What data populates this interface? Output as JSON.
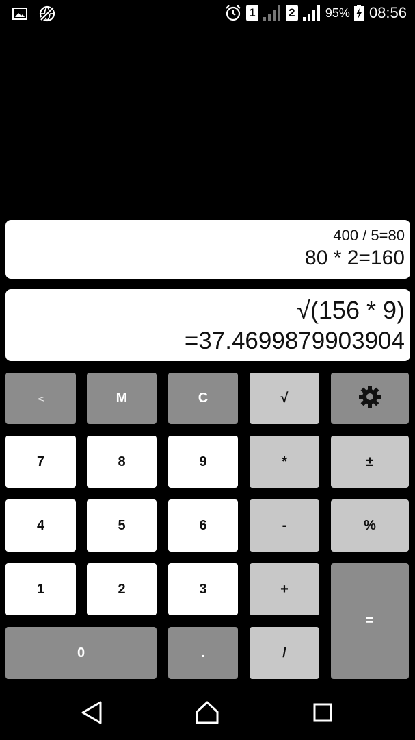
{
  "status_bar": {
    "icons_left": [
      "gallery-icon",
      "no-network-globe-icon"
    ],
    "alarm_icon": "alarm-clock-icon",
    "sim1_label": "1",
    "sim2_label": "2",
    "battery_percent": "95%",
    "time": "08:56"
  },
  "display": {
    "history_line1": "400 / 5=80",
    "history_line2": "80 * 2=160",
    "expression": "√(156 * 9)",
    "result": "=37.4699879903904"
  },
  "keypad": {
    "backspace": "◅",
    "memory": "M",
    "clear": "C",
    "sqrt": "√",
    "settings_icon": "gear-icon",
    "seven": "7",
    "eight": "8",
    "nine": "9",
    "multiply": "*",
    "plus_minus": "±",
    "four": "4",
    "five": "5",
    "six": "6",
    "minus": "-",
    "percent": "%",
    "one": "1",
    "two": "2",
    "three": "3",
    "plus": "+",
    "equals": "=",
    "zero": "0",
    "dot": ".",
    "divide": "/"
  },
  "colors": {
    "background": "#000000",
    "panel": "#ffffff",
    "key_dark": "#8c8c8c",
    "key_light": "#c8c8c8",
    "key_white": "#ffffff"
  }
}
